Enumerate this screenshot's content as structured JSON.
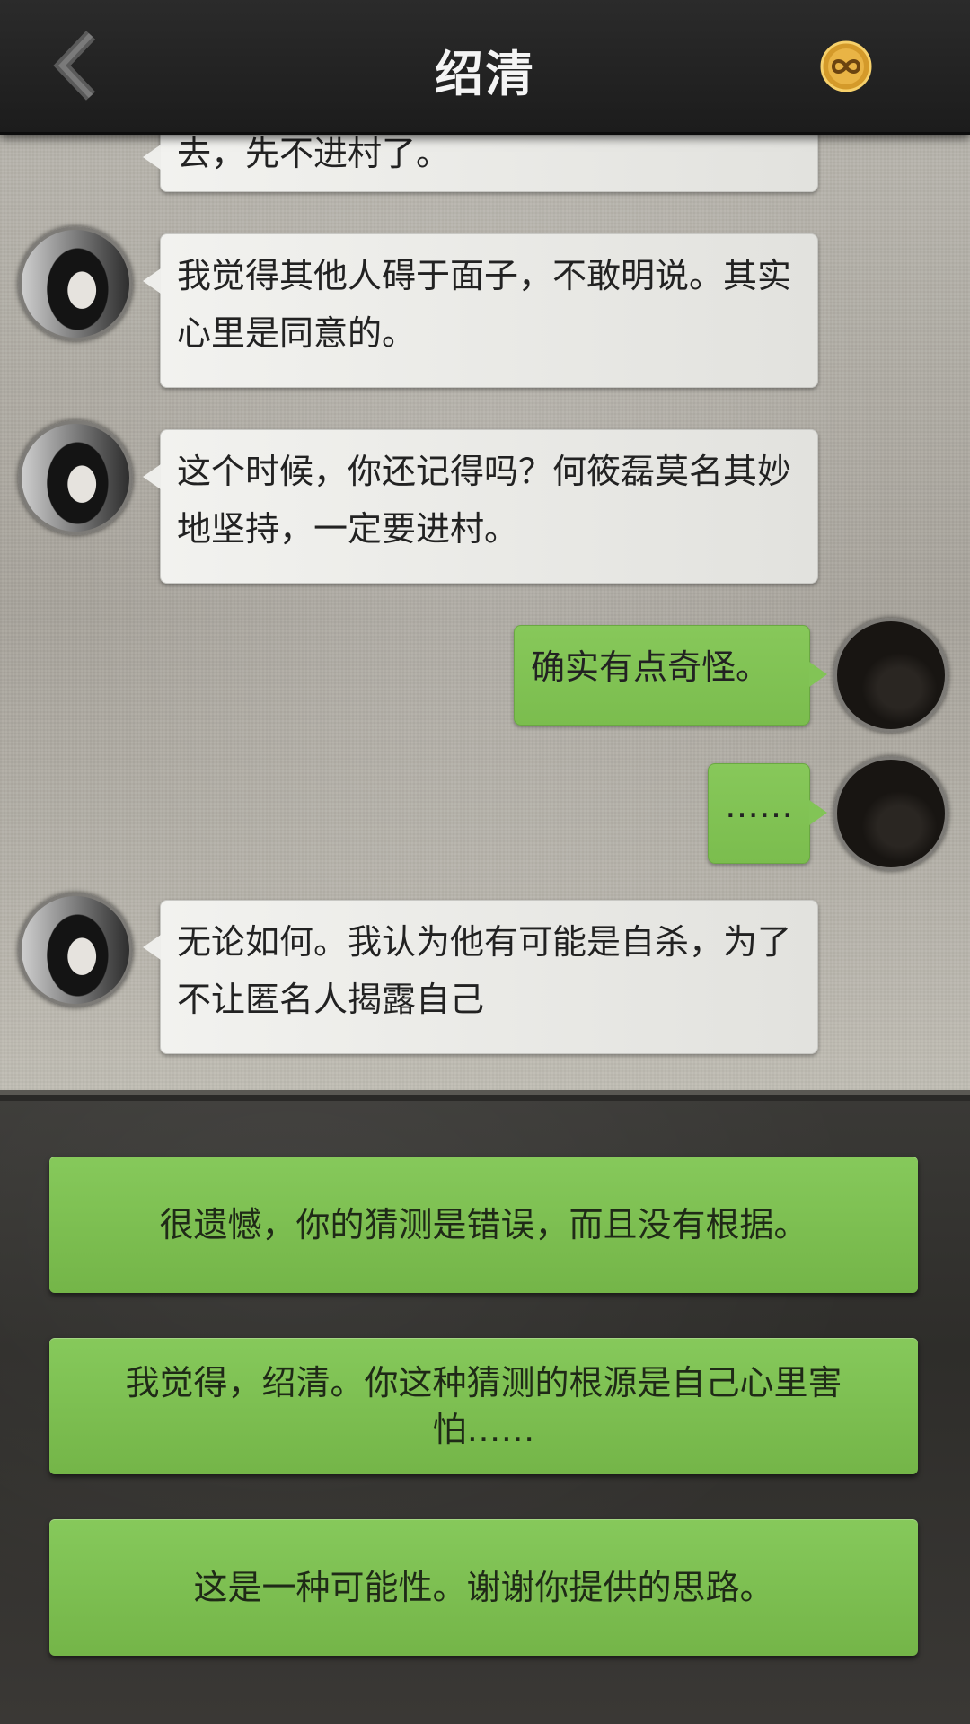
{
  "header": {
    "title": "绍清",
    "back_icon": "chevron-left-icon",
    "coin_icon": "infinity-coin-icon",
    "coin_color": "#e0a531"
  },
  "messages": [
    {
      "side": "left",
      "text": "去，先不进村了。",
      "partial": true
    },
    {
      "side": "left",
      "text": "我觉得其他人碍于面子，不敢明说。其实心里是同意的。"
    },
    {
      "side": "left",
      "text": "这个时候，你还记得吗？何筱磊莫名其妙地坚持，一定要进村。"
    },
    {
      "side": "right",
      "text": "确实有点奇怪。"
    },
    {
      "side": "right",
      "text": "……"
    },
    {
      "side": "left",
      "text": "无论如何。我认为他有可能是自杀，为了不让匿名人揭露自己"
    }
  ],
  "options": [
    {
      "label": "很遗憾，你的猜测是错误，而且没有根据。"
    },
    {
      "label": "我觉得，绍清。你这种猜测的根源是自己心里害怕……"
    },
    {
      "label": "这是一种可能性。谢谢你提供的思路。"
    }
  ],
  "colors": {
    "green_bubble": "#82c456",
    "gray_bubble": "#eeeeeb",
    "header_bg": "#1f1f1f"
  }
}
